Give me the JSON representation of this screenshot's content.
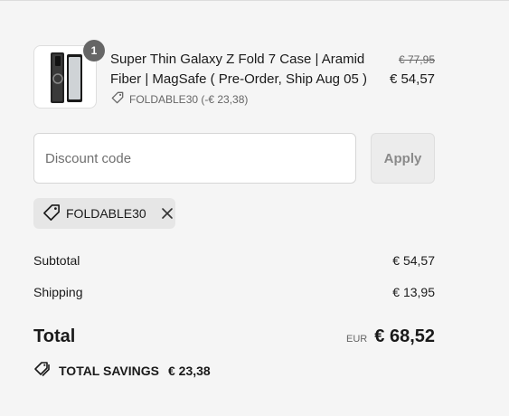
{
  "item": {
    "quantity": "1",
    "title": "Super Thin Galaxy Z Fold 7 Case | Aramid Fiber | MagSafe ( Pre-Order, Ship Aug 05 )",
    "discount_label": "FOLDABLE30 (-€ 23,38)",
    "original_price": "€ 77,95",
    "price": "€ 54,57"
  },
  "discount": {
    "placeholder": "Discount code",
    "apply_label": "Apply",
    "applied_code": "FOLDABLE30"
  },
  "summary": {
    "subtotal_label": "Subtotal",
    "subtotal_value": "€ 54,57",
    "shipping_label": "Shipping",
    "shipping_value": "€ 13,95",
    "total_label": "Total",
    "currency": "EUR",
    "total_value": "€ 68,52",
    "savings_label": "TOTAL SAVINGS",
    "savings_value": "€ 23,38"
  },
  "icons": {
    "tag": "tag-icon",
    "remove": "close-icon",
    "savings": "tags-icon"
  },
  "colors": {
    "background": "#f5f5f5",
    "badge": "#666666",
    "chip": "#e6e6e6"
  }
}
